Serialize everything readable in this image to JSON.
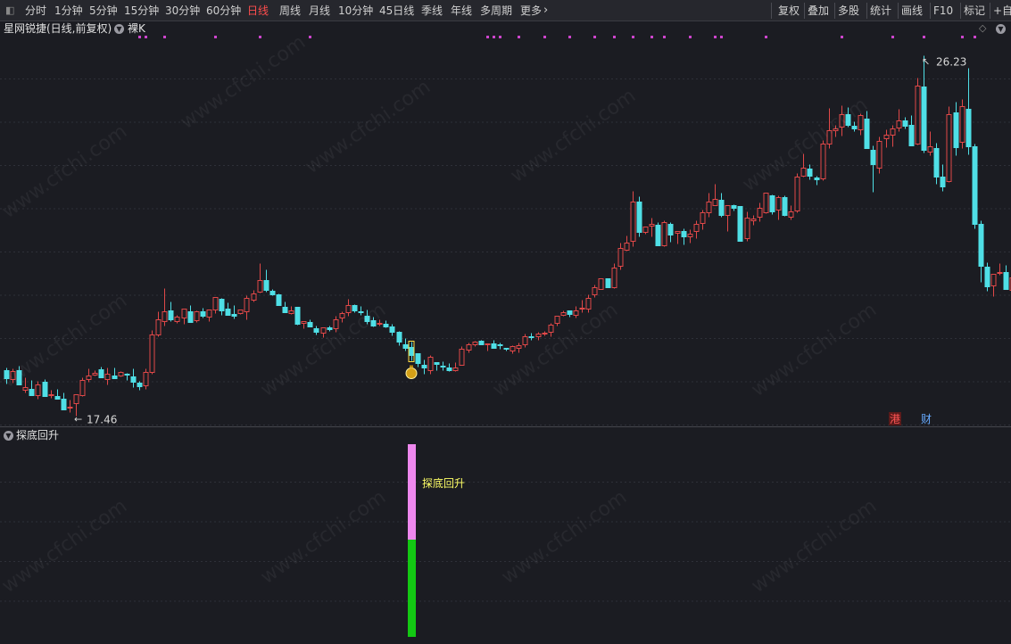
{
  "toolbar": {
    "left_items": [
      {
        "label": "分时",
        "active": false
      },
      {
        "label": "1分钟",
        "active": false
      },
      {
        "label": "5分钟",
        "active": false
      },
      {
        "label": "15分钟",
        "active": false
      },
      {
        "label": "30分钟",
        "active": false
      },
      {
        "label": "60分钟",
        "active": false
      },
      {
        "label": "日线",
        "active": true
      },
      {
        "label": "周线",
        "active": false
      },
      {
        "label": "月线",
        "active": false
      },
      {
        "label": "10分钟",
        "active": false
      },
      {
        "label": "45日线",
        "active": false
      },
      {
        "label": "季线",
        "active": false
      },
      {
        "label": "年线",
        "active": false
      },
      {
        "label": "多周期",
        "active": false
      },
      {
        "label": "更多",
        "active": false
      }
    ],
    "right_items": [
      "复权",
      "叠加",
      "多股",
      "统计",
      "画线",
      "F10",
      "标记",
      "+自选"
    ],
    "more_arrow": "›"
  },
  "main_pane": {
    "stock_title": "星网锐捷(日线,前复权)",
    "mode_label": "裸K",
    "high_label": "26.23",
    "low_label": "17.46",
    "badges": {
      "hk": "港",
      "finance": "财"
    },
    "colors": {
      "up": "#e04848",
      "down": "#4fdfe6",
      "marker": "#cc44cc",
      "bg": "#1b1c22"
    }
  },
  "sub_pane": {
    "indicator_title": "探底回升",
    "signal_label": "探底回升",
    "colors": {
      "bar_top": "#ee88ee",
      "bar_bottom": "#13c813",
      "label": "#ffff66"
    }
  },
  "watermark": "www.cfchi.com",
  "chart_data": {
    "type": "candlestick",
    "series": [
      {
        "o": 18.57,
        "h": 18.64,
        "l": 18.24,
        "c": 18.38
      },
      {
        "o": 18.34,
        "h": 18.62,
        "l": 18.27,
        "c": 18.54
      },
      {
        "o": 18.56,
        "h": 18.67,
        "l": 18.21,
        "c": 18.21
      },
      {
        "o": 18.09,
        "h": 18.4,
        "l": 18.02,
        "c": 18.15
      },
      {
        "o": 18.12,
        "h": 18.33,
        "l": 17.96,
        "c": 17.96
      },
      {
        "o": 17.96,
        "h": 18.31,
        "l": 17.87,
        "c": 18.21
      },
      {
        "o": 18.28,
        "h": 18.35,
        "l": 17.94,
        "c": 17.94
      },
      {
        "o": 17.97,
        "h": 18.08,
        "l": 17.89,
        "c": 17.97
      },
      {
        "o": 17.94,
        "h": 18.11,
        "l": 17.87,
        "c": 17.88
      },
      {
        "o": 17.88,
        "h": 18.03,
        "l": 17.61,
        "c": 17.61
      },
      {
        "o": 17.66,
        "h": 17.85,
        "l": 17.54,
        "c": 17.67
      },
      {
        "o": 17.77,
        "h": 17.98,
        "l": 17.46,
        "c": 17.97
      },
      {
        "o": 17.96,
        "h": 18.39,
        "l": 17.94,
        "c": 18.32
      },
      {
        "o": 18.35,
        "h": 18.61,
        "l": 18.29,
        "c": 18.44
      },
      {
        "o": 18.45,
        "h": 18.56,
        "l": 18.44,
        "c": 18.51
      },
      {
        "o": 18.58,
        "h": 18.65,
        "l": 18.4,
        "c": 18.4
      },
      {
        "o": 18.36,
        "h": 18.64,
        "l": 18.23,
        "c": 18.47
      },
      {
        "o": 18.44,
        "h": 18.63,
        "l": 18.37,
        "c": 18.37
      },
      {
        "o": 18.44,
        "h": 18.55,
        "l": 18.41,
        "c": 18.53
      },
      {
        "o": 18.49,
        "h": 18.51,
        "l": 18.32,
        "c": 18.45
      },
      {
        "o": 18.41,
        "h": 18.6,
        "l": 18.15,
        "c": 18.29
      },
      {
        "o": 18.27,
        "h": 18.3,
        "l": 18.08,
        "c": 18.17
      },
      {
        "o": 18.2,
        "h": 18.62,
        "l": 18.12,
        "c": 18.52
      },
      {
        "o": 18.52,
        "h": 19.54,
        "l": 18.48,
        "c": 19.43
      },
      {
        "o": 19.43,
        "h": 20.0,
        "l": 19.4,
        "c": 19.81
      },
      {
        "o": 19.76,
        "h": 20.56,
        "l": 19.66,
        "c": 20.0
      },
      {
        "o": 20.01,
        "h": 20.23,
        "l": 19.75,
        "c": 19.81
      },
      {
        "o": 19.76,
        "h": 19.91,
        "l": 19.72,
        "c": 19.86
      },
      {
        "o": 19.84,
        "h": 20.06,
        "l": 19.7,
        "c": 20.06
      },
      {
        "o": 19.99,
        "h": 20.14,
        "l": 19.73,
        "c": 19.73
      },
      {
        "o": 19.79,
        "h": 20.03,
        "l": 19.74,
        "c": 20.0
      },
      {
        "o": 19.99,
        "h": 20.09,
        "l": 19.85,
        "c": 19.9
      },
      {
        "o": 19.87,
        "h": 20.05,
        "l": 19.76,
        "c": 20.05
      },
      {
        "o": 20.05,
        "h": 20.35,
        "l": 19.96,
        "c": 20.35
      },
      {
        "o": 20.3,
        "h": 20.33,
        "l": 19.91,
        "c": 20.02
      },
      {
        "o": 20.07,
        "h": 20.21,
        "l": 19.92,
        "c": 19.92
      },
      {
        "o": 19.94,
        "h": 20.15,
        "l": 19.82,
        "c": 19.88
      },
      {
        "o": 19.96,
        "h": 20.05,
        "l": 19.93,
        "c": 20.04
      },
      {
        "o": 19.99,
        "h": 20.39,
        "l": 19.8,
        "c": 20.33
      },
      {
        "o": 20.28,
        "h": 20.52,
        "l": 20.24,
        "c": 20.44
      },
      {
        "o": 20.48,
        "h": 21.16,
        "l": 20.45,
        "c": 20.75
      },
      {
        "o": 20.76,
        "h": 21.02,
        "l": 20.47,
        "c": 20.51
      },
      {
        "o": 20.49,
        "h": 20.53,
        "l": 20.38,
        "c": 20.41
      },
      {
        "o": 20.42,
        "h": 20.43,
        "l": 20.14,
        "c": 20.15
      },
      {
        "o": 20.1,
        "h": 20.24,
        "l": 19.97,
        "c": 19.97
      },
      {
        "o": 19.95,
        "h": 20.12,
        "l": 19.93,
        "c": 20.01
      },
      {
        "o": 20.11,
        "h": 20.11,
        "l": 19.67,
        "c": 19.7
      },
      {
        "o": 19.71,
        "h": 19.75,
        "l": 19.59,
        "c": 19.75
      },
      {
        "o": 19.73,
        "h": 19.81,
        "l": 19.64,
        "c": 19.64
      },
      {
        "o": 19.58,
        "h": 19.65,
        "l": 19.44,
        "c": 19.49
      },
      {
        "o": 19.47,
        "h": 19.61,
        "l": 19.37,
        "c": 19.61
      },
      {
        "o": 19.61,
        "h": 19.65,
        "l": 19.52,
        "c": 19.56
      },
      {
        "o": 19.58,
        "h": 19.88,
        "l": 19.49,
        "c": 19.81
      },
      {
        "o": 19.84,
        "h": 20.0,
        "l": 19.73,
        "c": 19.96
      },
      {
        "o": 19.97,
        "h": 20.3,
        "l": 19.89,
        "c": 20.14
      },
      {
        "o": 20.15,
        "h": 20.18,
        "l": 19.98,
        "c": 20.01
      },
      {
        "o": 19.99,
        "h": 20.12,
        "l": 19.91,
        "c": 19.98
      },
      {
        "o": 19.89,
        "h": 20.05,
        "l": 19.7,
        "c": 19.77
      },
      {
        "o": 19.79,
        "h": 19.87,
        "l": 19.62,
        "c": 19.65
      },
      {
        "o": 19.69,
        "h": 19.8,
        "l": 19.65,
        "c": 19.71
      },
      {
        "o": 19.69,
        "h": 19.79,
        "l": 19.6,
        "c": 19.63
      },
      {
        "o": 19.62,
        "h": 19.69,
        "l": 19.42,
        "c": 19.49
      },
      {
        "o": 19.49,
        "h": 19.52,
        "l": 19.17,
        "c": 19.27
      },
      {
        "o": 19.2,
        "h": 19.35,
        "l": 19.05,
        "c": 19.11
      },
      {
        "o": 19.14,
        "h": 19.26,
        "l": 18.8,
        "c": 18.94
      },
      {
        "o": 18.97,
        "h": 18.98,
        "l": 18.66,
        "c": 18.73
      },
      {
        "o": 18.7,
        "h": 18.82,
        "l": 18.47,
        "c": 18.64
      },
      {
        "o": 18.56,
        "h": 18.93,
        "l": 18.48,
        "c": 18.9
      },
      {
        "o": 18.77,
        "h": 18.77,
        "l": 18.57,
        "c": 18.72
      },
      {
        "o": 18.67,
        "h": 18.78,
        "l": 18.57,
        "c": 18.66
      },
      {
        "o": 18.64,
        "h": 18.73,
        "l": 18.54,
        "c": 18.57
      },
      {
        "o": 18.57,
        "h": 18.76,
        "l": 18.54,
        "c": 18.64
      },
      {
        "o": 18.69,
        "h": 19.16,
        "l": 18.69,
        "c": 19.09
      },
      {
        "o": 19.06,
        "h": 19.23,
        "l": 19.01,
        "c": 19.2
      },
      {
        "o": 19.19,
        "h": 19.28,
        "l": 19.15,
        "c": 19.27
      },
      {
        "o": 19.28,
        "h": 19.31,
        "l": 19.19,
        "c": 19.19
      },
      {
        "o": 19.22,
        "h": 19.22,
        "l": 19.05,
        "c": 19.22
      },
      {
        "o": 19.21,
        "h": 19.3,
        "l": 19.11,
        "c": 19.11
      },
      {
        "o": 19.2,
        "h": 19.23,
        "l": 19.09,
        "c": 19.17
      },
      {
        "o": 19.1,
        "h": 19.1,
        "l": 19.04,
        "c": 19.08
      },
      {
        "o": 19.05,
        "h": 19.17,
        "l": 18.98,
        "c": 19.16
      },
      {
        "o": 19.1,
        "h": 19.23,
        "l": 18.99,
        "c": 19.17
      },
      {
        "o": 19.2,
        "h": 19.45,
        "l": 19.13,
        "c": 19.39
      },
      {
        "o": 19.38,
        "h": 19.48,
        "l": 19.31,
        "c": 19.36
      },
      {
        "o": 19.38,
        "h": 19.5,
        "l": 19.3,
        "c": 19.45
      },
      {
        "o": 19.45,
        "h": 19.52,
        "l": 19.42,
        "c": 19.48
      },
      {
        "o": 19.5,
        "h": 19.71,
        "l": 19.39,
        "c": 19.68
      },
      {
        "o": 19.71,
        "h": 19.89,
        "l": 19.65,
        "c": 19.89
      },
      {
        "o": 19.92,
        "h": 20.01,
        "l": 19.89,
        "c": 19.98
      },
      {
        "o": 20.02,
        "h": 20.02,
        "l": 19.87,
        "c": 19.94
      },
      {
        "o": 19.92,
        "h": 20.12,
        "l": 19.85,
        "c": 20.03
      },
      {
        "o": 20.07,
        "h": 20.29,
        "l": 19.98,
        "c": 20.09
      },
      {
        "o": 20.07,
        "h": 20.42,
        "l": 19.97,
        "c": 20.33
      },
      {
        "o": 20.41,
        "h": 20.65,
        "l": 20.34,
        "c": 20.58
      },
      {
        "o": 20.55,
        "h": 20.79,
        "l": 20.55,
        "c": 20.81
      },
      {
        "o": 20.8,
        "h": 20.81,
        "l": 20.59,
        "c": 20.59
      },
      {
        "o": 20.58,
        "h": 21.18,
        "l": 20.56,
        "c": 21.06
      },
      {
        "o": 21.1,
        "h": 21.67,
        "l": 21.02,
        "c": 21.53
      },
      {
        "o": 21.49,
        "h": 21.84,
        "l": 21.47,
        "c": 21.67
      },
      {
        "o": 21.71,
        "h": 22.92,
        "l": 21.58,
        "c": 22.67
      },
      {
        "o": 22.66,
        "h": 22.79,
        "l": 21.81,
        "c": 21.92
      },
      {
        "o": 21.93,
        "h": 22.05,
        "l": 21.89,
        "c": 22.05
      },
      {
        "o": 22.09,
        "h": 22.27,
        "l": 21.81,
        "c": 22.13
      },
      {
        "o": 22.1,
        "h": 22.17,
        "l": 21.61,
        "c": 21.61
      },
      {
        "o": 21.6,
        "h": 22.22,
        "l": 21.59,
        "c": 22.17
      },
      {
        "o": 22.13,
        "h": 22.17,
        "l": 21.69,
        "c": 21.87
      },
      {
        "o": 21.91,
        "h": 21.94,
        "l": 21.64,
        "c": 21.94
      },
      {
        "o": 21.96,
        "h": 22.01,
        "l": 21.62,
        "c": 21.82
      },
      {
        "o": 21.81,
        "h": 22.0,
        "l": 21.67,
        "c": 21.89
      },
      {
        "o": 21.95,
        "h": 22.2,
        "l": 21.78,
        "c": 22.13
      },
      {
        "o": 22.14,
        "h": 22.47,
        "l": 21.99,
        "c": 22.41
      },
      {
        "o": 22.41,
        "h": 22.88,
        "l": 22.3,
        "c": 22.66
      },
      {
        "o": 22.57,
        "h": 23.11,
        "l": 22.57,
        "c": 22.74
      },
      {
        "o": 22.71,
        "h": 22.89,
        "l": 22.29,
        "c": 22.35
      },
      {
        "o": 22.34,
        "h": 22.58,
        "l": 21.96,
        "c": 22.58
      },
      {
        "o": 22.58,
        "h": 22.6,
        "l": 22.45,
        "c": 22.52
      },
      {
        "o": 22.55,
        "h": 22.55,
        "l": 21.75,
        "c": 21.71
      },
      {
        "o": 21.78,
        "h": 22.42,
        "l": 21.71,
        "c": 22.28
      },
      {
        "o": 22.21,
        "h": 22.34,
        "l": 22.11,
        "c": 22.26
      },
      {
        "o": 22.3,
        "h": 22.65,
        "l": 22.18,
        "c": 22.51
      },
      {
        "o": 22.41,
        "h": 22.89,
        "l": 22.39,
        "c": 22.89
      },
      {
        "o": 22.82,
        "h": 22.85,
        "l": 22.36,
        "c": 22.43
      },
      {
        "o": 22.46,
        "h": 22.81,
        "l": 22.23,
        "c": 22.78
      },
      {
        "o": 22.78,
        "h": 22.82,
        "l": 22.32,
        "c": 22.33
      },
      {
        "o": 22.3,
        "h": 22.57,
        "l": 22.24,
        "c": 22.42
      },
      {
        "o": 22.44,
        "h": 23.37,
        "l": 22.41,
        "c": 23.27
      },
      {
        "o": 23.29,
        "h": 23.83,
        "l": 23.27,
        "c": 23.49
      },
      {
        "o": 23.47,
        "h": 23.57,
        "l": 23.2,
        "c": 23.29
      },
      {
        "o": 23.25,
        "h": 23.3,
        "l": 23.07,
        "c": 23.21
      },
      {
        "o": 23.23,
        "h": 24.17,
        "l": 23.19,
        "c": 24.07
      },
      {
        "o": 24.07,
        "h": 24.95,
        "l": 23.97,
        "c": 24.41
      },
      {
        "o": 24.4,
        "h": 24.53,
        "l": 24.24,
        "c": 24.45
      },
      {
        "o": 24.48,
        "h": 25.0,
        "l": 24.28,
        "c": 24.8
      },
      {
        "o": 24.79,
        "h": 24.96,
        "l": 24.48,
        "c": 24.54
      },
      {
        "o": 24.52,
        "h": 24.61,
        "l": 24.37,
        "c": 24.45
      },
      {
        "o": 24.43,
        "h": 24.81,
        "l": 24.29,
        "c": 24.76
      },
      {
        "o": 24.69,
        "h": 24.87,
        "l": 23.96,
        "c": 23.96
      },
      {
        "o": 23.93,
        "h": 24.04,
        "l": 22.9,
        "c": 23.57
      },
      {
        "o": 23.5,
        "h": 24.25,
        "l": 23.36,
        "c": 24.15
      },
      {
        "o": 24.2,
        "h": 24.43,
        "l": 23.99,
        "c": 24.3
      },
      {
        "o": 24.29,
        "h": 24.54,
        "l": 24.0,
        "c": 24.44
      },
      {
        "o": 24.47,
        "h": 24.92,
        "l": 24.38,
        "c": 24.65
      },
      {
        "o": 24.64,
        "h": 24.72,
        "l": 24.44,
        "c": 24.51
      },
      {
        "o": 24.53,
        "h": 24.76,
        "l": 24.03,
        "c": 24.03
      },
      {
        "o": 24.08,
        "h": 25.68,
        "l": 24.05,
        "c": 25.48
      },
      {
        "o": 25.47,
        "h": 26.23,
        "l": 23.86,
        "c": 23.93
      },
      {
        "o": 23.89,
        "h": 24.37,
        "l": 23.79,
        "c": 24.0
      },
      {
        "o": 23.97,
        "h": 24.1,
        "l": 23.09,
        "c": 23.28
      },
      {
        "o": 23.27,
        "h": 23.57,
        "l": 22.93,
        "c": 23.03
      },
      {
        "o": 23.17,
        "h": 24.99,
        "l": 23.14,
        "c": 24.8
      },
      {
        "o": 24.84,
        "h": 25.1,
        "l": 23.79,
        "c": 23.98
      },
      {
        "o": 24.11,
        "h": 25.16,
        "l": 23.97,
        "c": 24.99
      },
      {
        "o": 24.93,
        "h": 25.92,
        "l": 23.82,
        "c": 24.01
      },
      {
        "o": 24.0,
        "h": 24.08,
        "l": 22.01,
        "c": 22.12
      },
      {
        "o": 22.12,
        "h": 22.22,
        "l": 20.72,
        "c": 21.11
      },
      {
        "o": 21.09,
        "h": 21.19,
        "l": 20.5,
        "c": 20.61
      },
      {
        "o": 20.62,
        "h": 20.91,
        "l": 20.37,
        "c": 20.9
      },
      {
        "o": 20.92,
        "h": 21.18,
        "l": 20.89,
        "c": 20.96
      },
      {
        "o": 20.96,
        "h": 21.13,
        "l": 20.55,
        "c": 20.55
      },
      {
        "o": 20.51,
        "h": 20.87,
        "l": 20.45,
        "c": 20.83
      },
      {
        "o": 20.79,
        "h": 20.96,
        "l": 20.71,
        "c": 20.71
      },
      {
        "o": 20.62,
        "h": 20.64,
        "l": 20.42,
        "c": 20.45
      },
      {
        "o": 20.45,
        "h": 20.49,
        "l": 20.19,
        "c": 20.3
      },
      {
        "o": 20.25,
        "h": 20.26,
        "l": 20.09,
        "c": 20.17
      }
    ],
    "signal_index": 64,
    "top_marker_indices": [
      21,
      22,
      25,
      33,
      40,
      48,
      76,
      77,
      78,
      81,
      85,
      89,
      93,
      96,
      99,
      102,
      104,
      108,
      112,
      113,
      120,
      132,
      140,
      145,
      151,
      153
    ],
    "price_range": [
      17.2,
      26.7
    ],
    "high": 26.23,
    "low": 17.46
  }
}
